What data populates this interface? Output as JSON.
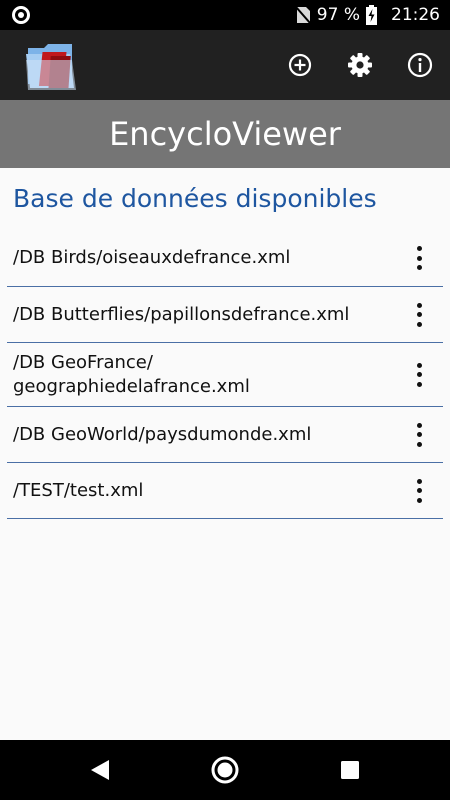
{
  "status_bar": {
    "battery_percent": "97 %",
    "time": "21:26",
    "icons": [
      "notification-circle-icon",
      "no-sim-icon",
      "battery-charging-icon"
    ]
  },
  "app_bar": {
    "actions": [
      {
        "name": "add",
        "icon": "add-circle-icon"
      },
      {
        "name": "settings",
        "icon": "gear-icon"
      },
      {
        "name": "info",
        "icon": "info-icon"
      }
    ]
  },
  "header": {
    "title": "EncycloViewer"
  },
  "main": {
    "section_title": "Base de données disponibles",
    "databases": [
      {
        "path": "/DB Birds/oiseauxdefrance.xml"
      },
      {
        "path": "/DB Butterflies/papillonsdefrance.xml"
      },
      {
        "path": "/DB GeoFrance/\ngeographiedelafrance.xml"
      },
      {
        "path": "/DB GeoWorld/paysdumonde.xml"
      },
      {
        "path": "/TEST/test.xml"
      }
    ]
  },
  "nav_bar": {
    "buttons": [
      "back-icon",
      "home-icon",
      "recents-icon"
    ]
  },
  "colors": {
    "app_bar": "#212121",
    "title_bar": "#757575",
    "accent": "#1e56a0",
    "divider": "#4a6fa5"
  }
}
